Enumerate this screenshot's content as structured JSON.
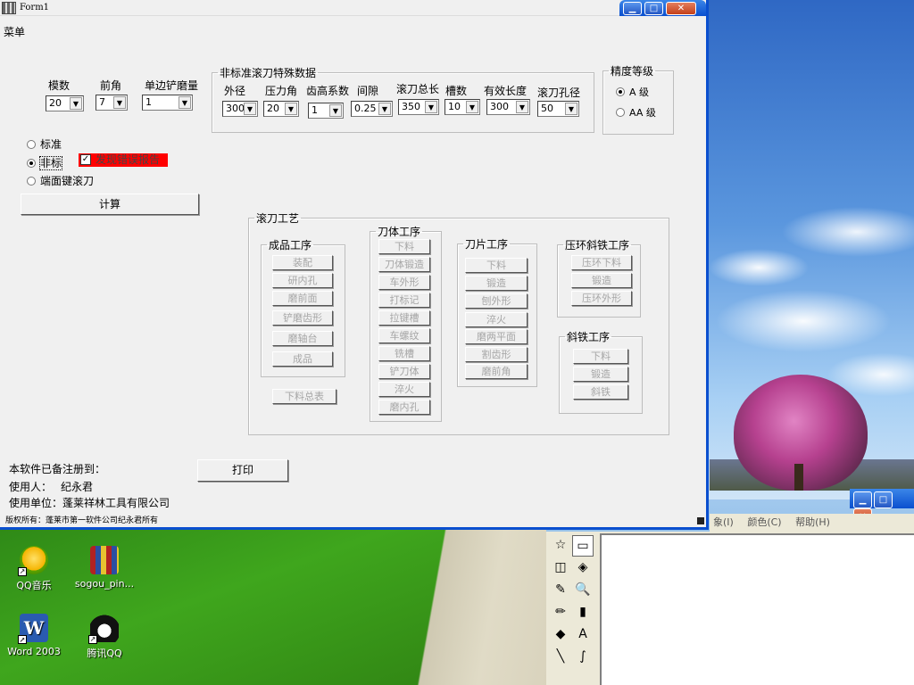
{
  "window": {
    "title": "Form1",
    "menu": "菜单"
  },
  "params": {
    "modulus_label": "模数",
    "modulus_value": "20",
    "rake_label": "前角",
    "rake_value": "7",
    "relief_label": "单边铲磨量",
    "relief_value": "1"
  },
  "nonstandard": {
    "group_title": "非标准滚刀特殊数据",
    "fields": [
      {
        "label": "外径",
        "value": "300"
      },
      {
        "label": "压力角",
        "value": "20"
      },
      {
        "label": "齿高系数",
        "value": "1"
      },
      {
        "label": "间隙",
        "value": "0.25"
      },
      {
        "label": "滚刀总长",
        "value": "350"
      },
      {
        "label": "槽数",
        "value": "10"
      },
      {
        "label": "有效长度",
        "value": "300"
      },
      {
        "label": "滚刀孔径",
        "value": "50"
      }
    ]
  },
  "precision": {
    "group_title": "精度等级",
    "a_label": "A 级",
    "aa_label": "AA 级"
  },
  "hob_type": {
    "standard": "标准",
    "nonstandard": "非标",
    "face_key": "端面键滚刀",
    "error_report": "发现错误报告"
  },
  "buttons": {
    "calculate": "计算",
    "print": "打印",
    "material_summary": "下料总表"
  },
  "process": {
    "group_title": "滚刀工艺",
    "finished": {
      "title": "成品工序",
      "items": [
        "装配",
        "研内孔",
        "磨前面",
        "铲磨齿形",
        "磨轴台",
        "成品"
      ]
    },
    "body": {
      "title": "刀体工序",
      "items": [
        "下料",
        "刀体锻造",
        "车外形",
        "打标记",
        "拉键槽",
        "车螺纹",
        "铣槽",
        "铲刀体",
        "淬火",
        "磨内孔"
      ]
    },
    "blade": {
      "title": "刀片工序",
      "items": [
        "下料",
        "锻造",
        "刨外形",
        "淬火",
        "磨两平面",
        "割齿形",
        "磨前角"
      ]
    },
    "ring": {
      "title": "压环斜铁工序",
      "items": [
        "压环下料",
        "锻造",
        "压环外形"
      ]
    },
    "wedge": {
      "title": "斜铁工序",
      "items": [
        "下料",
        "锻造",
        "斜铁"
      ]
    }
  },
  "registration": {
    "heading": "本软件已备注册到：",
    "user_label": "使用人：",
    "user_name": "纪永君",
    "org_label": "使用单位：",
    "org_name": "蓬莱祥林工具有限公司",
    "copyright": "版权所有：蓬莱市第一软件公司纪永君所有"
  },
  "desktop_icons": [
    {
      "label": "QQ音乐",
      "icon": "qq-music-icon"
    },
    {
      "label": "sogou_pin...",
      "icon": "winrar-archive-icon"
    },
    {
      "label": "Word 2003",
      "icon": "word-icon"
    },
    {
      "label": "腾讯QQ",
      "icon": "qq-penguin-icon"
    }
  ],
  "bg_window": {
    "menu_items": [
      "象(I)",
      "颜色(C)",
      "帮助(H)"
    ]
  },
  "paint_tools": [
    "☆",
    "▭",
    "◫",
    "◈",
    "✎",
    "🔍",
    "✏",
    "▮",
    "◆",
    "A",
    "╲",
    "∫"
  ],
  "colors": {
    "title_blue": "#0a4fcf",
    "error_red": "#ff0000"
  }
}
